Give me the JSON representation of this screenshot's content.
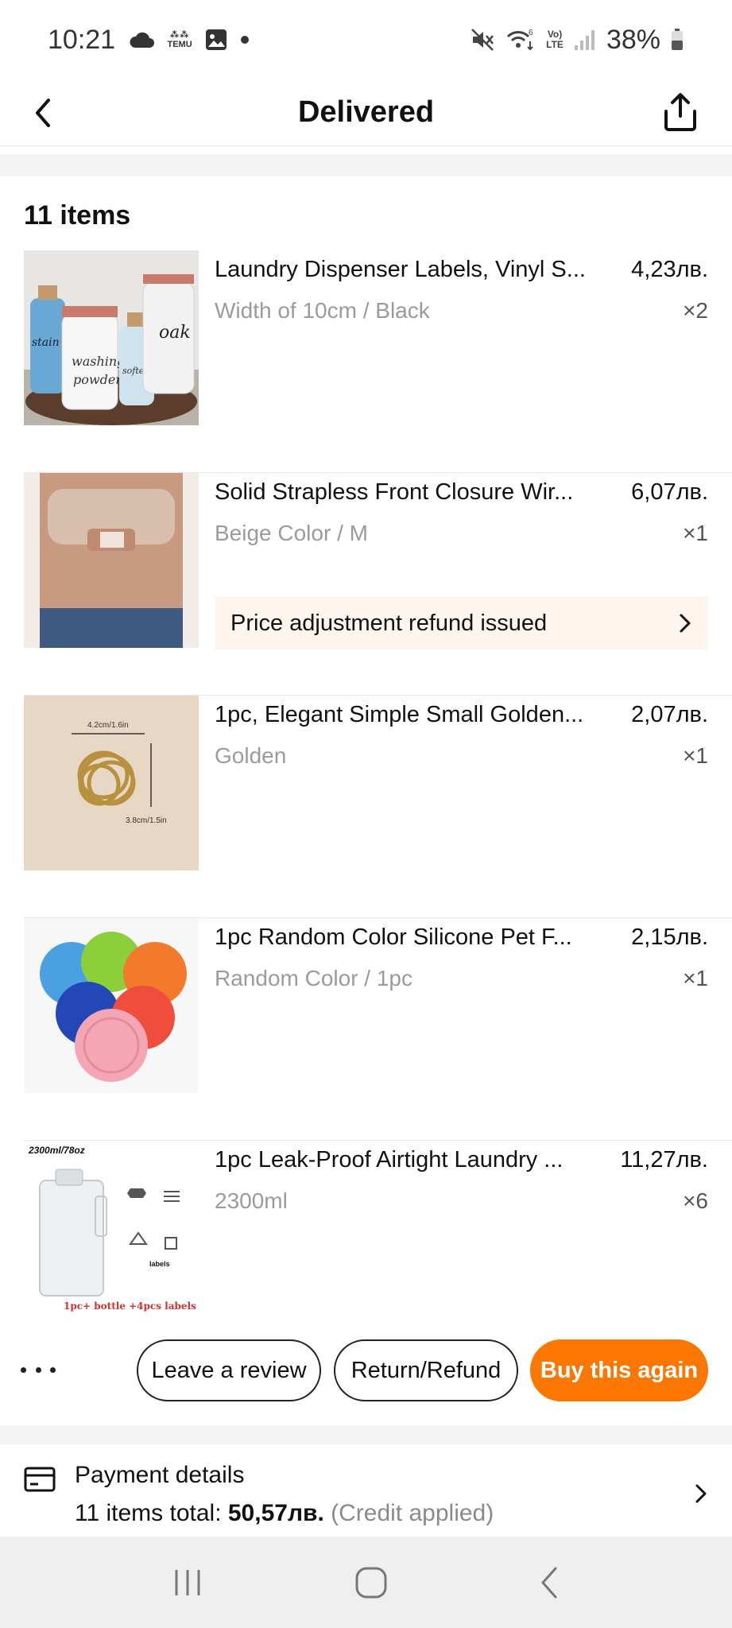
{
  "status_bar": {
    "time": "10:21",
    "battery": "38%",
    "icons": [
      "cloud-icon",
      "temu-app-icon",
      "gallery-icon",
      "notification-dot-icon",
      "mute-icon",
      "wifi-6-icon",
      "volte-icon",
      "signal-icon",
      "battery-icon"
    ],
    "volte_label": "Vo)\nLTE",
    "temu_label": "TEMU"
  },
  "header": {
    "title": "Delivered",
    "back_icon": "chevron-left-icon",
    "share_icon": "share-icon"
  },
  "order": {
    "items_count": "11 items",
    "items": [
      {
        "name": "Laundry Dispenser Labels, Vinyl S...",
        "price": "4,23лв.",
        "variant": "Width of 10cm / Black",
        "qty": "×2",
        "thumb": "laundry-jars-image"
      },
      {
        "name": "Solid Strapless Front Closure Wir...",
        "price": "6,07лв.",
        "variant": "Beige Color / M",
        "qty": "×1",
        "thumb": "strapless-bra-image",
        "banner": "Price adjustment refund issued"
      },
      {
        "name": "1pc, Elegant Simple Small Golden...",
        "price": "2,07лв.",
        "variant": "Golden",
        "qty": "×1",
        "thumb": "golden-hair-clip-image",
        "thumb_labels": [
          "4.2cm/1.6in",
          "3.8cm/1.5in"
        ]
      },
      {
        "name": "1pc Random Color Silicone Pet F...",
        "price": "2,15лв.",
        "variant": "Random Color / 1pc",
        "qty": "×1",
        "thumb": "silicone-lids-image"
      },
      {
        "name": "1pc Leak-Proof Airtight Laundry ...",
        "price": "11,27лв.",
        "variant": "2300ml",
        "qty": "×6",
        "thumb": "laundry-container-image",
        "thumb_labels": [
          "2300ml/78oz",
          "1pc+ bottle +4pcs labels"
        ]
      }
    ]
  },
  "actions": {
    "more_icon": "more-dots-icon",
    "leave_review": "Leave a review",
    "return_refund": "Return/Refund",
    "buy_again": "Buy this again"
  },
  "payment": {
    "title": "Payment details",
    "summary_label": "11 items total: ",
    "summary_amount": "50,57лв.",
    "summary_note": " (Credit applied)"
  },
  "nav": {
    "icons": [
      "recent-apps-icon",
      "home-icon",
      "back-icon"
    ]
  },
  "colors": {
    "accent": "#fb7701",
    "banner_bg": "#fef5ef",
    "muted_text": "#9b9b9b",
    "nav_bg": "#efefef"
  }
}
